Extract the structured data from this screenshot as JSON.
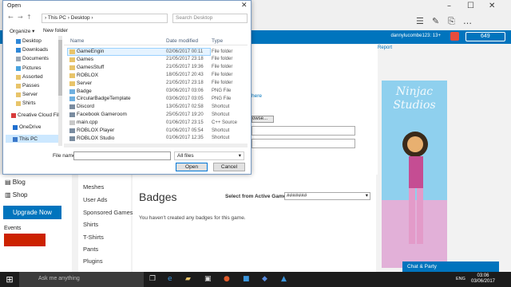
{
  "browser": {
    "icons": [
      "hub-icon",
      "notes-icon",
      "share-icon",
      "more-icon"
    ],
    "window_controls": [
      "minimize-icon",
      "maximize-icon",
      "close-icon"
    ]
  },
  "header": {
    "username": "dannylucombe123: 13+",
    "robux": "649"
  },
  "page": {
    "report_link": "Report",
    "behind_link": "here",
    "behind_browse": "owse...",
    "left_nav": [
      {
        "label": "Blog"
      },
      {
        "label": "Shop"
      }
    ],
    "upgrade_button": "Upgrade Now",
    "events_label": "Events",
    "categories": [
      "Meshes",
      "User Ads",
      "Sponsored Games",
      "Shirts",
      "T-Shirts",
      "Pants",
      "Plugins"
    ],
    "badges_title": "Badges",
    "select_label": "Select from Active Games:",
    "select_value": "#######",
    "empty_message": "You haven't created any badges for this game.",
    "ad_text": "Ninjac Studios",
    "chat_party": "Chat & Party"
  },
  "dialog": {
    "title": "Open",
    "breadcrumb": "› This PC › Desktop ›",
    "search_placeholder": "Search Desktop",
    "organize": "Organize ▾",
    "new_folder": "New folder",
    "nav_items": [
      {
        "label": "Desktop",
        "icon": "desktop-icon"
      },
      {
        "label": "Downloads",
        "icon": "downloads-icon"
      },
      {
        "label": "Documents",
        "icon": "documents-icon"
      },
      {
        "label": "Pictures",
        "icon": "pictures-icon"
      },
      {
        "label": "Assorted",
        "icon": "folder-icon"
      },
      {
        "label": "Passes",
        "icon": "folder-icon"
      },
      {
        "label": "Server",
        "icon": "folder-icon"
      },
      {
        "label": "Shirts",
        "icon": "folder-icon"
      },
      {
        "label": "Creative Cloud Fil",
        "icon": "cloud-icon"
      },
      {
        "label": "OneDrive",
        "icon": "onedrive-icon"
      },
      {
        "label": "This PC",
        "icon": "pc-icon"
      }
    ],
    "columns": {
      "name": "Name",
      "date": "Date modified",
      "type": "Type"
    },
    "files": [
      {
        "name": "GameEngin",
        "date": "02/06/2017 00:11",
        "type": "File folder",
        "icon": "folder-icon"
      },
      {
        "name": "Games",
        "date": "21/05/2017 23:18",
        "type": "File folder",
        "icon": "folder-icon"
      },
      {
        "name": "GamesStuff",
        "date": "21/05/2017 19:36",
        "type": "File folder",
        "icon": "folder-icon"
      },
      {
        "name": "ROBLOX",
        "date": "18/05/2017 20:43",
        "type": "File folder",
        "icon": "folder-icon"
      },
      {
        "name": "Server",
        "date": "21/05/2017 23:18",
        "type": "File folder",
        "icon": "folder-icon"
      },
      {
        "name": "Badge",
        "date": "03/06/2017 03:06",
        "type": "PNG File",
        "icon": "image-icon"
      },
      {
        "name": "CircularBadgeTemplate",
        "date": "03/06/2017 03:05",
        "type": "PNG File",
        "icon": "image-icon"
      },
      {
        "name": "Discord",
        "date": "13/05/2017 02:58",
        "type": "Shortcut",
        "icon": "shortcut-icon"
      },
      {
        "name": "Facebook Gameroom",
        "date": "25/05/2017 19:20",
        "type": "Shortcut",
        "icon": "shortcut-icon"
      },
      {
        "name": "main.cpp",
        "date": "01/06/2017 23:15",
        "type": "C++ Source",
        "icon": "file-icon"
      },
      {
        "name": "ROBLOX Player",
        "date": "01/06/2017 05:54",
        "type": "Shortcut",
        "icon": "shortcut-icon"
      },
      {
        "name": "ROBLOX Studio",
        "date": "01/06/2017 12:35",
        "type": "Shortcut",
        "icon": "shortcut-icon"
      }
    ],
    "file_name_label": "File name:",
    "file_name_value": "",
    "file_type": "All files",
    "open_button": "Open",
    "cancel_button": "Cancel"
  },
  "taskbar": {
    "search_placeholder": "Ask me anything",
    "language": "ENG",
    "time": "03:06",
    "date": "03/06/2017"
  },
  "colors": {
    "roblox_blue": "#0074bd",
    "taskbar": "#1c1c1c",
    "selection": "#cce8ff"
  }
}
